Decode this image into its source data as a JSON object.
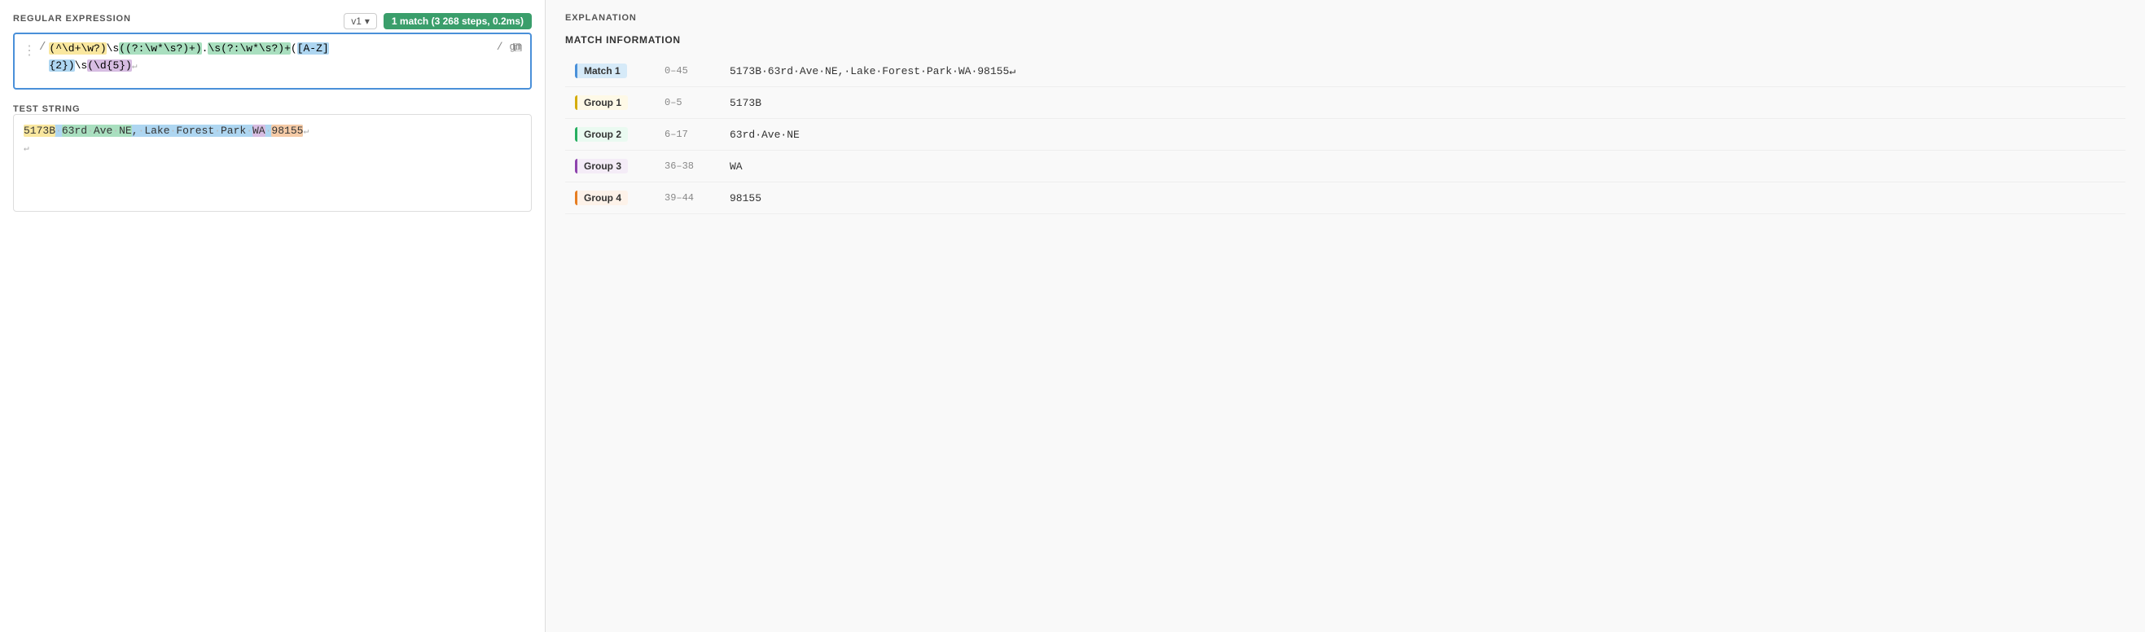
{
  "left": {
    "regex_label": "REGULAR EXPRESSION",
    "version": "v1",
    "match_badge": "1 match (3 268 steps, 0.2ms)",
    "regex_line1_parts": [
      {
        "text": "(^\\d+\\w?)\\s((?:\\w*\\s?)+).",
        "class": "hl-yellow"
      },
      {
        "text": "\\s(?:\\w*\\s?)+",
        "class": "hl-green"
      },
      {
        "text": "(",
        "class": ""
      },
      {
        "text": "[A-Z]",
        "class": "hl-blue"
      },
      {
        "text": "",
        "class": ""
      }
    ],
    "regex_display_line1": "(^\\d+\\w?)\\s((?:\\w*\\s?)+).\\s(?:\\w*\\s?)+([A-Z]",
    "regex_display_line2": "{2})\\s(\\d{5})",
    "flags": "/ gm",
    "test_label": "TEST STRING",
    "copy_icon": "⧉",
    "drag_icon": "⋮"
  },
  "right": {
    "explanation_label": "EXPLANATION",
    "match_info_label": "MATCH INFORMATION",
    "rows": [
      {
        "group_label": "Match 1",
        "badge_class": "badge-match",
        "range": "0-45",
        "value": "5173B·63rd·Ave·NE,·Lake·Forest·Park·WA·98155↵"
      },
      {
        "group_label": "Group 1",
        "badge_class": "badge-group1",
        "range": "0-5",
        "value": "5173B"
      },
      {
        "group_label": "Group 2",
        "badge_class": "badge-group2",
        "range": "6-17",
        "value": "63rd·Ave·NE"
      },
      {
        "group_label": "Group 3",
        "badge_class": "badge-group3",
        "range": "36-38",
        "value": "WA"
      },
      {
        "group_label": "Group 4",
        "badge_class": "badge-group4",
        "range": "39-44",
        "value": "98155"
      }
    ]
  }
}
